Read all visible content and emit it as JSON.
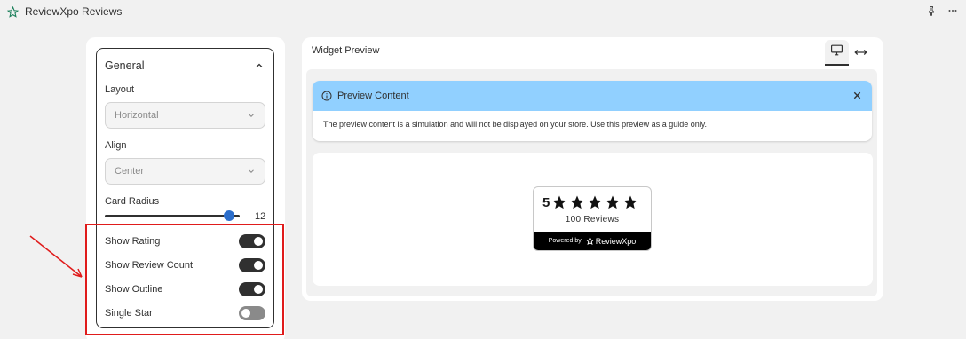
{
  "app": {
    "title": "ReviewXpo Reviews",
    "logo_icon": "star-outline-icon"
  },
  "top_actions": [
    {
      "icon": "pin-icon"
    },
    {
      "icon": "more-horizontal-icon"
    }
  ],
  "settings": {
    "section_title": "General",
    "layout": {
      "label": "Layout",
      "value": "Horizontal"
    },
    "align": {
      "label": "Align",
      "value": "Center"
    },
    "card_radius": {
      "label": "Card Radius",
      "value": "12",
      "fraction": 0.92
    },
    "toggles": [
      {
        "label": "Show Rating",
        "on": true
      },
      {
        "label": "Show Review Count",
        "on": true
      },
      {
        "label": "Show Outline",
        "on": true
      },
      {
        "label": "Single Star",
        "on": false
      }
    ]
  },
  "preview": {
    "title": "Widget Preview",
    "view_modes": [
      "desktop-icon",
      "fullwidth-icon"
    ],
    "banner": {
      "title": "Preview Content",
      "text": "The preview content is a simulation and will not be displayed on your store. Use this preview as a guide only."
    },
    "widget": {
      "score": "5",
      "stars": 5,
      "count_text": "100 Reviews",
      "powered_text": "Powered by",
      "brand": "ReviewXpo"
    }
  },
  "colors": {
    "annotation": "#e01b1b",
    "banner": "#91d0ff",
    "slider_thumb": "#2c6ecb"
  }
}
